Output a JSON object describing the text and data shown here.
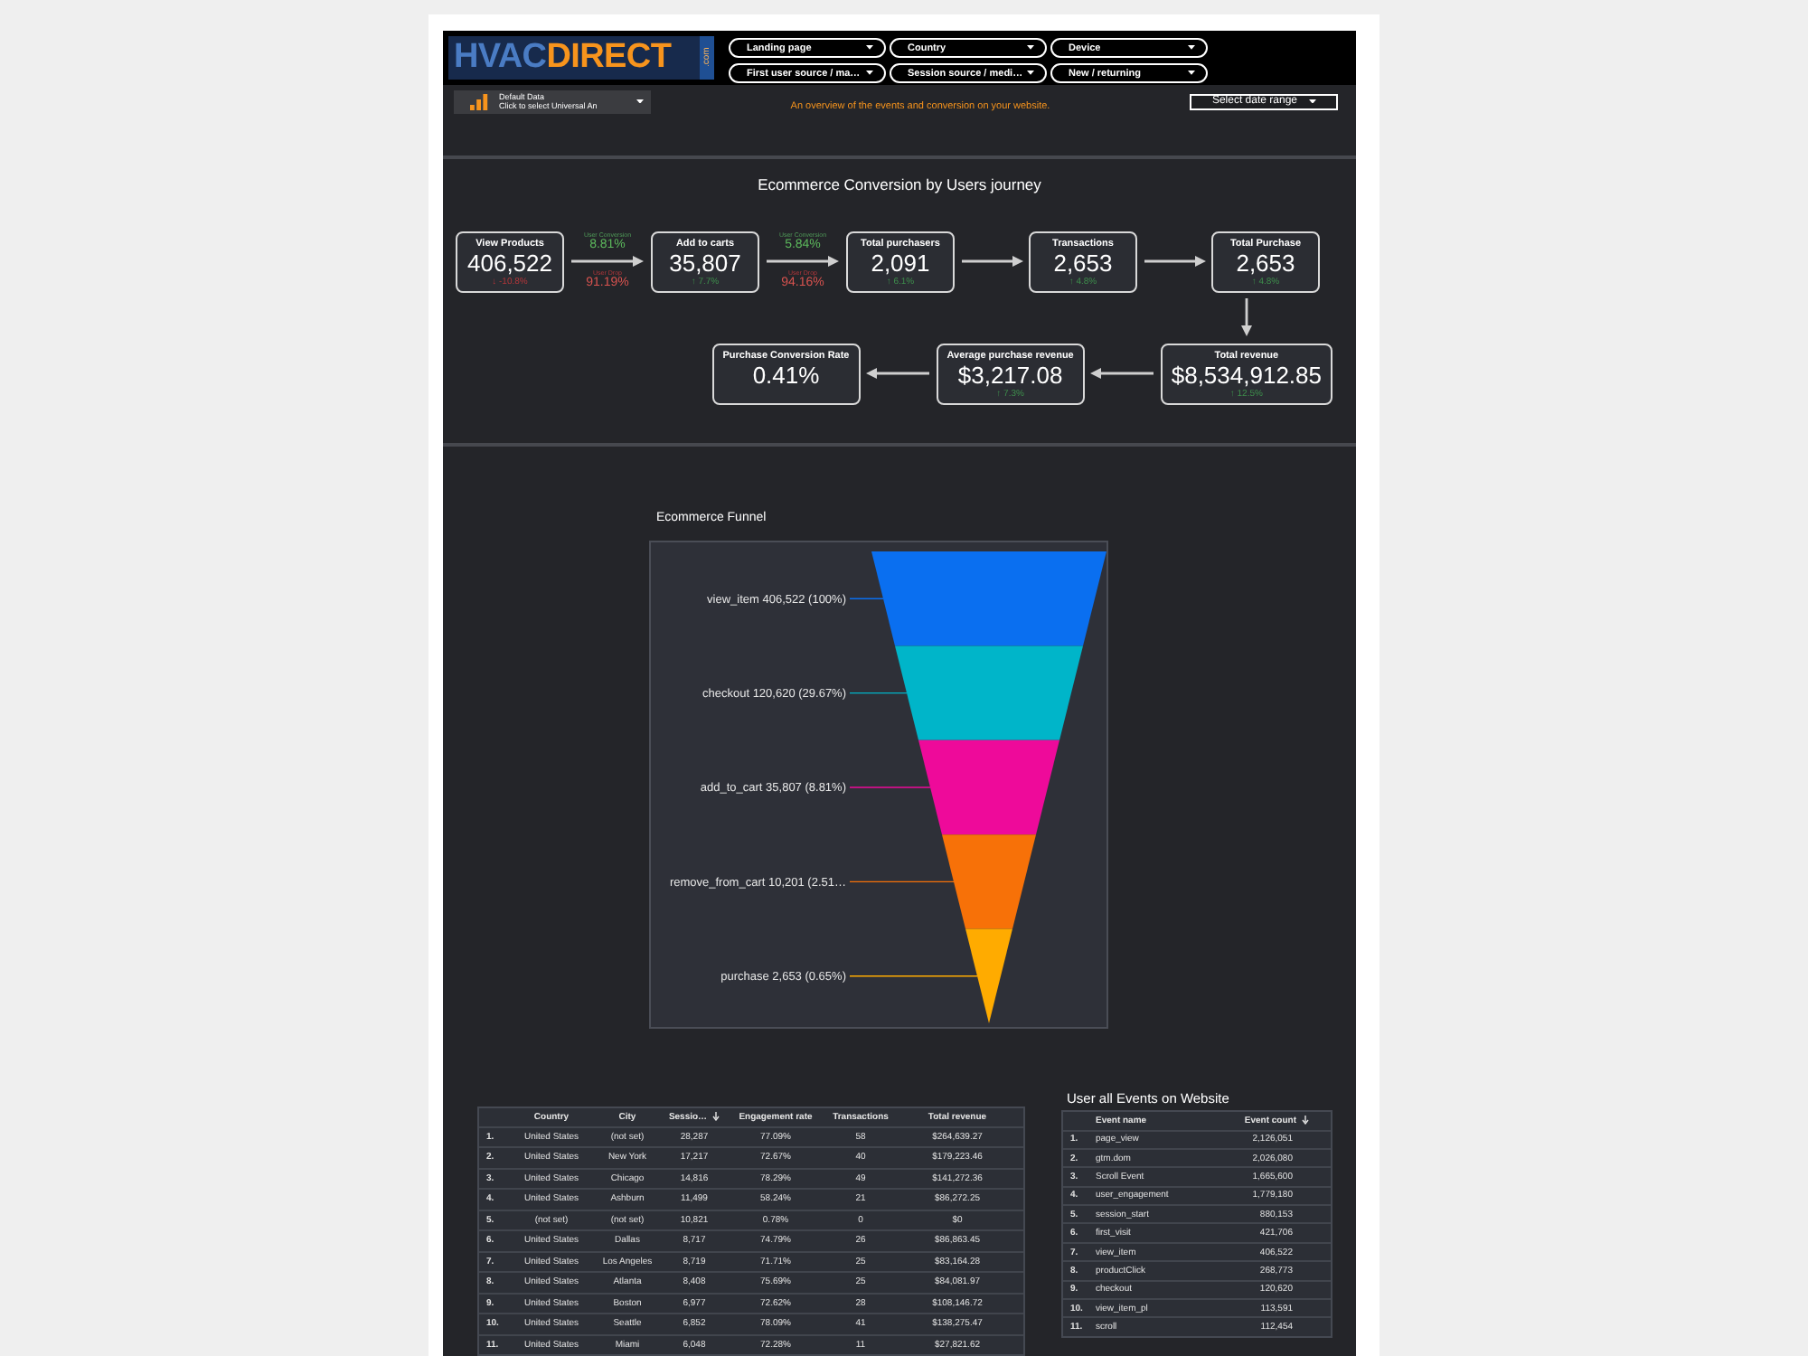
{
  "header": {
    "logo": {
      "part_1": "HVAC",
      "part_2": "DIRECT",
      "suffix": ".com"
    },
    "filters": [
      {
        "label": "Landing page"
      },
      {
        "label": "Country"
      },
      {
        "label": "Device"
      },
      {
        "label": "First user source / ma…"
      },
      {
        "label": "Session source / medi…"
      },
      {
        "label": "New / returning"
      }
    ],
    "data_source": {
      "title": "Default Data",
      "subtitle": "Click to select Universal An"
    },
    "subtitle": "An overview of the events and conversion on your website.",
    "date_range": {
      "label": "Select date range"
    }
  },
  "journey": {
    "title": "Ecommerce Conversion by Users journey",
    "row_1": [
      {
        "kind": "metric",
        "label": "View Products",
        "value": "406,522",
        "delta": "↓ -10.8%",
        "positive": false
      },
      {
        "kind": "rates",
        "conversion_label": "User Conversion",
        "conversion": "8.81%",
        "drop_label": "User Drop",
        "drop": "91.19%"
      },
      {
        "kind": "metric",
        "label": "Add to carts",
        "value": "35,807",
        "delta": "↑ 7.7%",
        "positive": true
      },
      {
        "kind": "rates",
        "conversion_label": "User Conversion",
        "conversion": "5.84%",
        "drop_label": "User Drop",
        "drop": "94.16%"
      },
      {
        "kind": "metric",
        "label": "Total purchasers",
        "value": "2,091",
        "delta": "↑ 6.1%",
        "positive": true
      },
      {
        "kind": "arrow"
      },
      {
        "kind": "metric",
        "label": "Transactions",
        "value": "2,653",
        "delta": "↑ 4.8%",
        "positive": true
      },
      {
        "kind": "arrow"
      },
      {
        "kind": "metric",
        "label": "Total Purchase",
        "value": "2,653",
        "delta": "↑ 4.8%",
        "positive": true
      }
    ],
    "turn": {
      "kind": "arrow"
    },
    "row_2": [
      {
        "kind": "metric",
        "label": "Purchase Conversion Rate",
        "value": "0.41%"
      },
      {
        "kind": "arrow"
      },
      {
        "kind": "metric",
        "label": "Average purchase revenue",
        "value": "$3,217.08",
        "delta": "↑ 7.3%",
        "positive": true
      },
      {
        "kind": "arrow"
      },
      {
        "kind": "metric",
        "label": "Total revenue",
        "value": "$8,534,912.85",
        "delta": "↑ 12.5%",
        "positive": true
      }
    ]
  },
  "funnel": {
    "title": "Ecommerce Funnel",
    "stages": [
      {
        "label": "view_item 406,522 (100%)",
        "color": "#0a6ff0"
      },
      {
        "label": "checkout 120,620 (29.67%)",
        "color": "#00b5c9"
      },
      {
        "label": "add_to_cart 35,807 (8.81%)",
        "color": "#ee0a9a"
      },
      {
        "label": "remove_from_cart 10,201 (2.51…",
        "color": "#f77108"
      },
      {
        "label": "purchase 2,653 (0.65%)",
        "color": "#ffab00"
      }
    ]
  },
  "sessions_table": {
    "columns": [
      {
        "label": "Country",
        "sorted": false
      },
      {
        "label": "City",
        "sorted": false
      },
      {
        "label": "Sessio…",
        "sorted": true
      },
      {
        "label": "Engagement rate",
        "sorted": false
      },
      {
        "label": "Transactions",
        "sorted": false
      },
      {
        "label": "Total revenue",
        "sorted": false
      }
    ],
    "rows": [
      {
        "index": "1.",
        "cells": [
          "United States",
          "(not set)",
          "28,287",
          "77.09%",
          "58",
          "$264,639.27"
        ]
      },
      {
        "index": "2.",
        "cells": [
          "United States",
          "New York",
          "17,217",
          "72.67%",
          "40",
          "$179,223.46"
        ]
      },
      {
        "index": "3.",
        "cells": [
          "United States",
          "Chicago",
          "14,816",
          "78.29%",
          "49",
          "$141,272.36"
        ]
      },
      {
        "index": "4.",
        "cells": [
          "United States",
          "Ashburn",
          "11,499",
          "58.24%",
          "21",
          "$86,272.25"
        ]
      },
      {
        "index": "5.",
        "cells": [
          "(not set)",
          "(not set)",
          "10,821",
          "0.78%",
          "0",
          "$0"
        ]
      },
      {
        "index": "6.",
        "cells": [
          "United States",
          "Dallas",
          "8,717",
          "74.79%",
          "26",
          "$86,863.45"
        ]
      },
      {
        "index": "7.",
        "cells": [
          "United States",
          "Los Angeles",
          "8,719",
          "71.71%",
          "25",
          "$83,164.28"
        ]
      },
      {
        "index": "8.",
        "cells": [
          "United States",
          "Atlanta",
          "8,408",
          "75.69%",
          "25",
          "$84,081.97"
        ]
      },
      {
        "index": "9.",
        "cells": [
          "United States",
          "Boston",
          "6,977",
          "72.62%",
          "28",
          "$108,146.72"
        ]
      },
      {
        "index": "10.",
        "cells": [
          "United States",
          "Seattle",
          "6,852",
          "78.09%",
          "41",
          "$138,275.47"
        ]
      },
      {
        "index": "11.",
        "cells": [
          "United States",
          "Miami",
          "6,048",
          "72.28%",
          "11",
          "$27,821.62"
        ]
      }
    ]
  },
  "events": {
    "title": "User all Events on Website",
    "columns": [
      {
        "label": "Event name",
        "sorted": false
      },
      {
        "label": "Event count",
        "sorted": true
      }
    ],
    "rows": [
      {
        "index": "1.",
        "cells": [
          "page_view",
          "2,126,051"
        ]
      },
      {
        "index": "2.",
        "cells": [
          "gtm.dom",
          "2,026,080"
        ]
      },
      {
        "index": "3.",
        "cells": [
          "Scroll Event",
          "1,665,600"
        ]
      },
      {
        "index": "4.",
        "cells": [
          "user_engagement",
          "1,779,180"
        ]
      },
      {
        "index": "5.",
        "cells": [
          "session_start",
          "880,153"
        ]
      },
      {
        "index": "6.",
        "cells": [
          "first_visit",
          "421,706"
        ]
      },
      {
        "index": "7.",
        "cells": [
          "view_item",
          "406,522"
        ]
      },
      {
        "index": "8.",
        "cells": [
          "productClick",
          "268,773"
        ]
      },
      {
        "index": "9.",
        "cells": [
          "checkout",
          "120,620"
        ]
      },
      {
        "index": "10.",
        "cells": [
          "view_item_pl",
          "113,591"
        ]
      },
      {
        "index": "11.",
        "cells": [
          "scroll",
          "112,454"
        ]
      }
    ]
  }
}
